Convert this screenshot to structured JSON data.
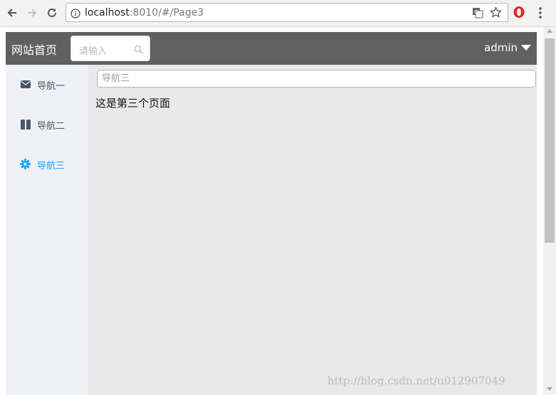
{
  "browser": {
    "url_host": "localhost",
    "url_rest": ":8010/#/Page3"
  },
  "app": {
    "logo": "网站首页",
    "search_placeholder": "请输入",
    "user": "admin"
  },
  "sidebar": {
    "items": [
      {
        "label": "导航一",
        "icon": "envelope-icon"
      },
      {
        "label": "导航二",
        "icon": "columns-icon"
      },
      {
        "label": "导航三",
        "icon": "gear-icon",
        "active": true
      }
    ]
  },
  "main": {
    "input_placeholder": "导航三",
    "text": "这是第三个页面"
  },
  "watermark": "http://blog.csdn.net/u012907049",
  "colors": {
    "header_bg": "#606060",
    "sidebar_bg": "#eef1f6",
    "main_bg": "#e9e9e9",
    "active": "#20a0ff"
  }
}
